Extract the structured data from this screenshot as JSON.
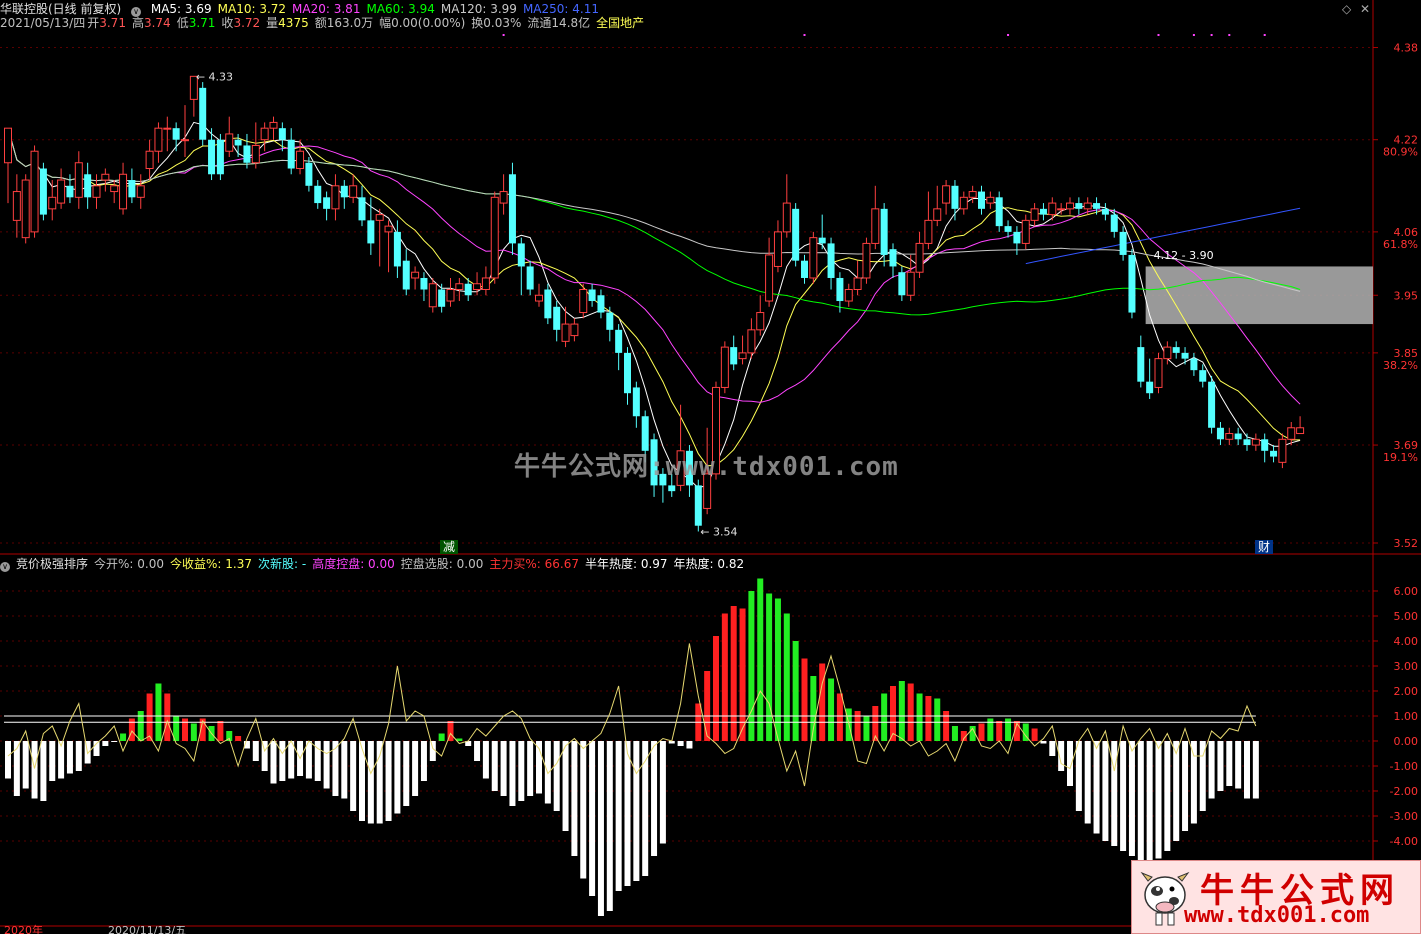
{
  "header1": {
    "stock": "华联控股(日线 前复权)",
    "ma": [
      {
        "label": "MA5: 3.69",
        "color": "#ffffff"
      },
      {
        "label": "MA10: 3.72",
        "color": "#ffff55"
      },
      {
        "label": "MA20: 3.81",
        "color": "#ff44ff"
      },
      {
        "label": "MA60: 3.94",
        "color": "#00ff00"
      },
      {
        "label": "MA120: 3.99",
        "color": "#c8c8c8"
      },
      {
        "label": "MA250: 4.11",
        "color": "#4466ff"
      }
    ]
  },
  "header2": {
    "date": "2021/05/13/四",
    "open_label": "开",
    "open": "3.71",
    "high_label": "高",
    "high": "3.74",
    "low_label": "低",
    "low": "3.71",
    "close_label": "收",
    "close": "3.72",
    "vol_label": "量",
    "vol": "4375",
    "amount": "额163.0万",
    "amp": "幅0.00(0.00%)",
    "turnover": "换0.03%",
    "float": "流通14.8亿",
    "sector": "全国地产"
  },
  "header3": {
    "title": "竞价极强排序",
    "items": [
      {
        "label": "今开%:",
        "value": "0.00",
        "color": "#c0c0c0"
      },
      {
        "label": "今收益%:",
        "value": "1.37",
        "color": "#ffff55"
      },
      {
        "label": "次新股:",
        "value": "-",
        "color": "#55ffff"
      },
      {
        "label": "高度控盘:",
        "value": "0.00",
        "color": "#ff44ff"
      },
      {
        "label": "控盘选股:",
        "value": "0.00",
        "color": "#c0c0c0"
      },
      {
        "label": "主力买%:",
        "value": "66.67",
        "color": "#ff3333"
      },
      {
        "label": "半年热度:",
        "value": "0.97",
        "color": "#ffffff"
      },
      {
        "label": "年热度:",
        "value": "0.82",
        "color": "#ffffff"
      }
    ]
  },
  "controls": {
    "diamond": "◇",
    "close": "✕"
  },
  "watermark": "牛牛公式网:www.tdx001.com",
  "logo": {
    "title": "牛牛公式网",
    "url": "www.tdx001.com"
  },
  "tags": {
    "jian": "减",
    "cai": "财"
  },
  "annotations": {
    "high": "4.33",
    "low": "3.54",
    "box": "4.12 - 3.90"
  },
  "axis_top": [
    {
      "v": "4.38",
      "p": ""
    },
    {
      "v": "4.22",
      "p": "80.9%"
    },
    {
      "v": "4.06",
      "p": "61.8%"
    },
    {
      "v": "3.95",
      "p": ""
    },
    {
      "v": "3.85",
      "p": "38.2%"
    },
    {
      "v": "3.69",
      "p": "19.1%"
    },
    {
      "v": "3.52",
      "p": ""
    }
  ],
  "axis_bottom": [
    "6.00",
    "5.00",
    "4.00",
    "3.00",
    "2.00",
    "1.00",
    "0.00",
    "-1.00",
    "-2.00",
    "-3.00",
    "-4.00"
  ],
  "date_labels": [
    "2020年",
    "2020/11/13/五"
  ],
  "chart_data": {
    "type": "candlestick",
    "candles": [
      [
        4.18,
        4.24,
        4.23,
        4.11
      ],
      [
        4.08,
        4.13,
        4.16,
        4.05
      ],
      [
        4.05,
        4.15,
        4.16,
        4.04
      ],
      [
        4.06,
        4.2,
        4.21,
        4.05
      ],
      [
        4.17,
        4.09,
        4.18,
        4.08
      ],
      [
        4.1,
        4.12,
        4.15,
        4.08
      ],
      [
        4.11,
        4.15,
        4.17,
        4.1
      ],
      [
        4.14,
        4.12,
        4.16,
        4.11
      ],
      [
        4.12,
        4.18,
        4.2,
        4.1
      ],
      [
        4.16,
        4.12,
        4.18,
        4.1
      ],
      [
        4.12,
        4.14,
        4.16,
        4.1
      ],
      [
        4.15,
        4.16,
        4.17,
        4.13
      ],
      [
        4.13,
        4.14,
        4.15,
        4.11
      ],
      [
        4.1,
        4.16,
        4.18,
        4.09
      ],
      [
        4.15,
        4.12,
        4.17,
        4.11
      ],
      [
        4.12,
        4.14,
        4.16,
        4.1
      ],
      [
        4.17,
        4.2,
        4.22,
        4.15
      ],
      [
        4.2,
        4.24,
        4.25,
        4.18
      ],
      [
        4.24,
        4.24,
        4.26,
        4.2
      ],
      [
        4.24,
        4.22,
        4.25,
        4.2
      ],
      [
        4.22,
        4.22,
        4.28,
        4.19
      ],
      [
        4.29,
        4.33,
        4.33,
        4.26
      ],
      [
        4.31,
        4.22,
        4.32,
        4.21
      ],
      [
        4.22,
        4.16,
        4.24,
        4.15
      ],
      [
        4.22,
        4.16,
        4.23,
        4.15
      ],
      [
        4.2,
        4.23,
        4.26,
        4.19
      ],
      [
        4.22,
        4.21,
        4.23,
        4.19
      ],
      [
        4.21,
        4.18,
        4.23,
        4.17
      ],
      [
        4.18,
        4.21,
        4.25,
        4.17
      ],
      [
        4.22,
        4.24,
        4.25,
        4.2
      ],
      [
        4.24,
        4.25,
        4.26,
        4.22
      ],
      [
        4.24,
        4.22,
        4.25,
        4.2
      ],
      [
        4.22,
        4.17,
        4.24,
        4.16
      ],
      [
        4.17,
        4.2,
        4.22,
        4.16
      ],
      [
        4.18,
        4.14,
        4.19,
        4.13
      ],
      [
        4.14,
        4.11,
        4.15,
        4.1
      ],
      [
        4.12,
        4.1,
        4.13,
        4.08
      ],
      [
        4.1,
        4.14,
        4.16,
        4.08
      ],
      [
        4.14,
        4.12,
        4.15,
        4.1
      ],
      [
        4.12,
        4.14,
        4.16,
        4.11
      ],
      [
        4.12,
        4.08,
        4.14,
        4.07
      ],
      [
        4.08,
        4.04,
        4.12,
        4.02
      ],
      [
        4.08,
        4.09,
        4.1,
        4.0
      ],
      [
        4.06,
        4.07,
        4.08,
        3.99
      ],
      [
        4.06,
        4.0,
        4.08,
        3.98
      ],
      [
        4.01,
        3.96,
        4.03,
        3.95
      ],
      [
        3.98,
        3.99,
        4.0,
        3.96
      ],
      [
        3.98,
        3.96,
        3.99,
        3.94
      ],
      [
        3.93,
        3.97,
        3.98,
        3.92
      ],
      [
        3.96,
        3.93,
        3.97,
        3.92
      ],
      [
        3.94,
        3.96,
        3.98,
        3.93
      ],
      [
        3.96,
        3.97,
        3.98,
        3.94
      ],
      [
        3.97,
        3.95,
        3.98,
        3.94
      ],
      [
        3.96,
        3.97,
        3.99,
        3.95
      ],
      [
        3.96,
        3.98,
        4.0,
        3.95
      ],
      [
        3.98,
        4.12,
        4.13,
        3.97
      ],
      [
        4.11,
        4.13,
        4.16,
        4.09
      ],
      [
        4.16,
        4.04,
        4.18,
        4.02
      ],
      [
        4.04,
        4.0,
        4.05,
        3.95
      ],
      [
        4.0,
        3.96,
        4.01,
        3.95
      ],
      [
        3.94,
        3.95,
        3.97,
        3.93
      ],
      [
        3.96,
        3.91,
        3.97,
        3.9
      ],
      [
        3.93,
        3.89,
        3.94,
        3.87
      ],
      [
        3.87,
        3.9,
        3.93,
        3.86
      ],
      [
        3.88,
        3.9,
        3.91,
        3.87
      ],
      [
        3.92,
        3.96,
        3.97,
        3.91
      ],
      [
        3.96,
        3.94,
        3.97,
        3.93
      ],
      [
        3.95,
        3.92,
        3.96,
        3.91
      ],
      [
        3.92,
        3.89,
        3.93,
        3.87
      ],
      [
        3.89,
        3.85,
        3.9,
        3.82
      ],
      [
        3.85,
        3.78,
        3.86,
        3.76
      ],
      [
        3.79,
        3.74,
        3.8,
        3.72
      ],
      [
        3.74,
        3.68,
        3.75,
        3.66
      ],
      [
        3.7,
        3.62,
        3.71,
        3.6
      ],
      [
        3.64,
        3.62,
        3.65,
        3.59
      ],
      [
        3.62,
        3.61,
        3.64,
        3.6
      ],
      [
        3.62,
        3.68,
        3.76,
        3.61
      ],
      [
        3.68,
        3.62,
        3.69,
        3.6
      ],
      [
        3.62,
        3.55,
        3.63,
        3.54
      ],
      [
        3.58,
        3.64,
        3.72,
        3.57
      ],
      [
        3.64,
        3.79,
        3.8,
        3.63
      ],
      [
        3.79,
        3.86,
        3.87,
        3.78
      ],
      [
        3.86,
        3.83,
        3.88,
        3.82
      ],
      [
        3.84,
        3.85,
        3.88,
        3.83
      ],
      [
        3.85,
        3.89,
        3.91,
        3.84
      ],
      [
        3.89,
        3.92,
        3.95,
        3.88
      ],
      [
        3.94,
        4.02,
        4.05,
        3.93
      ],
      [
        4.0,
        4.06,
        4.08,
        3.99
      ],
      [
        4.06,
        4.11,
        4.16,
        4.05
      ],
      [
        4.1,
        4.01,
        4.11,
        4.0
      ],
      [
        4.01,
        3.98,
        4.02,
        3.97
      ],
      [
        3.98,
        4.05,
        4.06,
        3.97
      ],
      [
        4.05,
        4.04,
        4.09,
        4.03
      ],
      [
        4.04,
        3.98,
        4.05,
        3.96
      ],
      [
        3.98,
        3.94,
        3.99,
        3.92
      ],
      [
        3.94,
        3.96,
        3.97,
        3.93
      ],
      [
        3.96,
        3.98,
        4.01,
        3.95
      ],
      [
        3.98,
        4.04,
        4.05,
        3.97
      ],
      [
        4.04,
        4.1,
        4.14,
        4.03
      ],
      [
        4.1,
        4.02,
        4.11,
        4.0
      ],
      [
        4.03,
        4.0,
        4.04,
        3.98
      ],
      [
        3.99,
        3.95,
        4.0,
        3.94
      ],
      [
        3.95,
        3.99,
        4.02,
        3.94
      ],
      [
        3.99,
        4.04,
        4.06,
        3.98
      ],
      [
        4.04,
        4.08,
        4.13,
        4.03
      ],
      [
        4.08,
        4.1,
        4.14,
        4.07
      ],
      [
        4.11,
        4.14,
        4.15,
        4.09
      ],
      [
        4.14,
        4.1,
        4.15,
        4.08
      ],
      [
        4.1,
        4.12,
        4.13,
        4.09
      ],
      [
        4.12,
        4.13,
        4.14,
        4.11
      ],
      [
        4.13,
        4.1,
        4.14,
        4.09
      ],
      [
        4.11,
        4.12,
        4.13,
        4.1
      ],
      [
        4.12,
        4.07,
        4.13,
        4.06
      ],
      [
        4.07,
        4.06,
        4.08,
        4.05
      ],
      [
        4.06,
        4.04,
        4.07,
        4.02
      ],
      [
        4.04,
        4.08,
        4.09,
        4.03
      ],
      [
        4.08,
        4.1,
        4.11,
        4.07
      ],
      [
        4.1,
        4.09,
        4.11,
        4.08
      ],
      [
        4.09,
        4.11,
        4.12,
        4.08
      ],
      [
        4.1,
        4.1,
        4.11,
        4.09
      ],
      [
        4.1,
        4.11,
        4.12,
        4.09
      ],
      [
        4.11,
        4.1,
        4.12,
        4.09
      ],
      [
        4.1,
        4.11,
        4.12,
        4.09
      ],
      [
        4.11,
        4.1,
        4.12,
        4.09
      ],
      [
        4.1,
        4.09,
        4.11,
        4.08
      ],
      [
        4.09,
        4.06,
        4.1,
        4.05
      ],
      [
        4.06,
        4.02,
        4.07,
        4.01
      ],
      [
        4.02,
        3.92,
        4.03,
        3.91
      ],
      [
        3.86,
        3.8,
        3.88,
        3.79
      ],
      [
        3.8,
        3.78,
        3.84,
        3.77
      ],
      [
        3.79,
        3.84,
        3.85,
        3.78
      ],
      [
        3.84,
        3.86,
        3.87,
        3.83
      ],
      [
        3.86,
        3.85,
        3.87,
        3.84
      ],
      [
        3.85,
        3.84,
        3.86,
        3.83
      ],
      [
        3.84,
        3.82,
        3.85,
        3.81
      ],
      [
        3.82,
        3.8,
        3.83,
        3.79
      ],
      [
        3.8,
        3.72,
        3.81,
        3.71
      ],
      [
        3.72,
        3.7,
        3.73,
        3.69
      ],
      [
        3.7,
        3.71,
        3.72,
        3.69
      ],
      [
        3.71,
        3.7,
        3.72,
        3.69
      ],
      [
        3.7,
        3.69,
        3.71,
        3.68
      ],
      [
        3.69,
        3.7,
        3.71,
        3.68
      ],
      [
        3.7,
        3.68,
        3.71,
        3.66
      ],
      [
        3.68,
        3.67,
        3.69,
        3.66
      ],
      [
        3.66,
        3.7,
        3.71,
        3.65
      ],
      [
        3.7,
        3.72,
        3.73,
        3.69
      ],
      [
        3.71,
        3.72,
        3.74,
        3.71
      ]
    ],
    "bars": [
      -1.5,
      -2.2,
      -1.9,
      -2.3,
      -2.4,
      -1.6,
      -1.5,
      -1.3,
      -1.2,
      -0.9,
      -0.6,
      -0.2,
      0.0,
      0.3,
      0.9,
      1.2,
      1.9,
      2.3,
      1.9,
      1.0,
      0.9,
      0.7,
      0.9,
      0.6,
      0.8,
      0.4,
      0.2,
      -0.3,
      -0.8,
      -1.2,
      -1.7,
      -1.6,
      -1.5,
      -1.4,
      -1.5,
      -1.6,
      -1.9,
      -2.2,
      -2.3,
      -2.8,
      -3.2,
      -3.3,
      -3.3,
      -3.2,
      -2.9,
      -2.6,
      -2.2,
      -1.6,
      -0.8,
      0.3,
      0.8,
      0.1,
      -0.2,
      -0.8,
      -1.5,
      -2.0,
      -2.2,
      -2.6,
      -2.4,
      -2.2,
      -2.1,
      -2.5,
      -2.8,
      -3.6,
      -4.6,
      -5.5,
      -6.2,
      -7.0,
      -6.8,
      -6.0,
      -5.8,
      -5.6,
      -5.4,
      -4.6,
      -4.1,
      -0.1,
      -0.2,
      -0.3,
      1.5,
      2.8,
      4.2,
      5.1,
      5.4,
      5.3,
      6.0,
      6.5,
      5.9,
      5.7,
      5.1,
      4.0,
      3.3,
      2.6,
      3.1,
      2.5,
      1.9,
      1.3,
      1.2,
      1.0,
      1.4,
      1.9,
      2.2,
      2.4,
      2.3,
      1.9,
      1.8,
      1.7,
      1.2,
      0.6,
      0.4,
      0.6,
      0.7,
      0.9,
      0.8,
      0.9,
      0.8,
      0.7,
      0.5,
      -0.1,
      -0.6,
      -1.2,
      -1.8,
      -2.8,
      -3.3,
      -3.7,
      -4.0,
      -4.2,
      -4.4,
      -4.6,
      -4.8,
      -4.8,
      -4.7,
      -4.4,
      -4.0,
      -3.6,
      -3.3,
      -2.8,
      -2.3,
      -2.0,
      -1.8,
      -1.9,
      -2.3,
      -2.3
    ],
    "wave": [
      -0.6,
      -0.3,
      0.4,
      -1.1,
      0.3,
      0.6,
      -0.2,
      0.8,
      1.5,
      -0.5,
      -0.1,
      0.2,
      0.6,
      -0.4,
      0.4,
      0.0,
      0.2,
      -0.4,
      0.8,
      -0.1,
      -0.3,
      -0.8,
      0.8,
      0.3,
      -0.1,
      0.1,
      -1.0,
      0.1,
      0.9,
      -0.4,
      0.1,
      -0.5,
      0.0,
      -0.7,
      0.0,
      -0.3,
      -0.5,
      -0.3,
      0.1,
      0.9,
      -0.3,
      -1.3,
      -0.6,
      0.7,
      3.0,
      0.8,
      1.2,
      1.0,
      -0.3,
      -0.6,
      0.3,
      -0.1,
      0.0,
      0.5,
      0.2,
      0.6,
      1.0,
      1.2,
      0.9,
      0.1,
      -0.3,
      -1.3,
      -0.9,
      -0.2,
      0.1,
      -0.3,
      0.0,
      0.3,
      1.1,
      2.2,
      -0.5,
      -1.3,
      -0.8,
      -0.2,
      0.1,
      0.0,
      1.5,
      3.9,
      1.8,
      0.2,
      -0.1,
      -0.5,
      -0.3,
      0.5,
      1.2,
      2.0,
      1.5,
      0.1,
      -1.2,
      -0.4,
      -1.8,
      0.5,
      2.3,
      3.4,
      2.1,
      0.7,
      -0.8,
      -0.9,
      0.2,
      -0.4,
      0.3,
      0.1,
      -0.2,
      0.0,
      -0.6,
      -0.4,
      -0.1,
      -0.8,
      0.1,
      0.5,
      -0.2,
      -0.3,
      0.0,
      -0.5,
      0.7,
      0.2,
      -0.2,
      0.1,
      0.6,
      -0.9,
      -1.1,
      0.0,
      0.5,
      -0.3,
      0.4,
      -1.2,
      0.6,
      -0.4,
      0.1,
      0.5,
      -0.3,
      0.3,
      -0.5,
      0.5,
      -0.6,
      -0.6,
      0.4,
      0.1,
      0.5,
      0.4,
      1.4,
      0.6
    ],
    "ma": {
      "MA5": 3.69,
      "MA10": 3.72,
      "MA20": 3.81,
      "MA60": 3.94,
      "MA120": 3.99,
      "MA250": 4.11
    },
    "price_range": [
      3.52,
      4.4
    ],
    "indicator_range": [
      -4.0,
      6.0
    ],
    "ref_lines": [
      0.75,
      1.0
    ]
  }
}
